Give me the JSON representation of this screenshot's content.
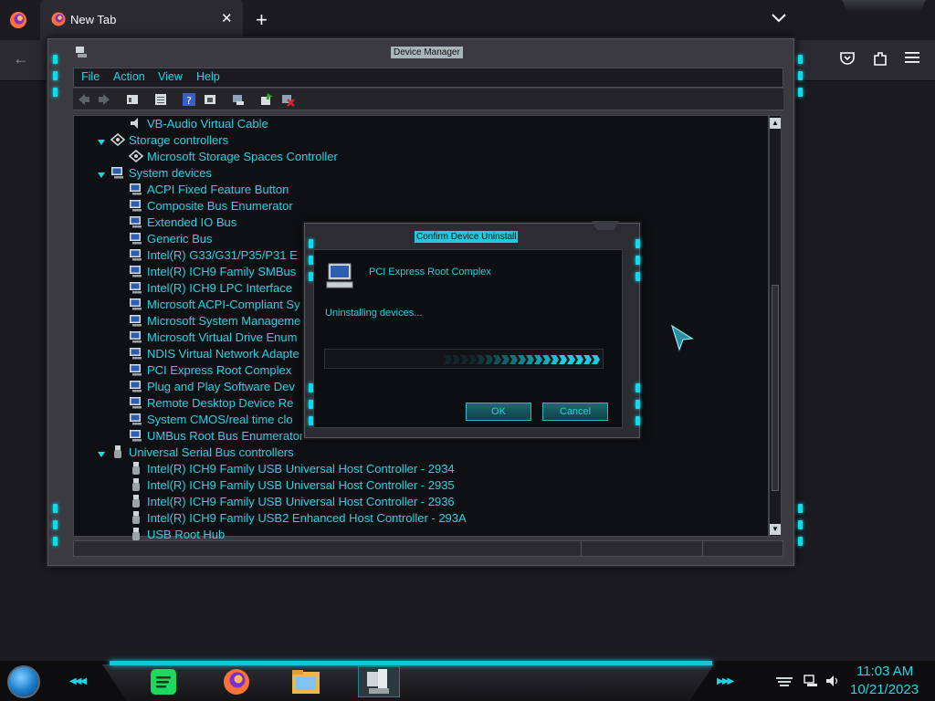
{
  "browser": {
    "tab_title": "New Tab",
    "close_glyph": "✕",
    "new_tab_glyph": "+",
    "back_glyph": "←"
  },
  "device_manager": {
    "title": "Device Manager",
    "menu": [
      "File",
      "Action",
      "View",
      "Help"
    ],
    "tree": [
      {
        "label": "VB-Audio Virtual Cable",
        "level": 2,
        "icon": "speaker-icon"
      },
      {
        "label": "Storage controllers",
        "level": 1,
        "icon": "storage-icon",
        "expanded": true
      },
      {
        "label": "Microsoft Storage Spaces Controller",
        "level": 2,
        "icon": "storage-icon"
      },
      {
        "label": "System devices",
        "level": 1,
        "icon": "computer-icon",
        "expanded": true
      },
      {
        "label": "ACPI Fixed Feature Button",
        "level": 2,
        "icon": "computer-icon"
      },
      {
        "label": "Composite Bus Enumerator",
        "level": 2,
        "icon": "computer-icon"
      },
      {
        "label": "Extended IO Bus",
        "level": 2,
        "icon": "computer-icon"
      },
      {
        "label": "Generic Bus",
        "level": 2,
        "icon": "computer-icon"
      },
      {
        "label": "Intel(R) G33/G31/P35/P31 E",
        "level": 2,
        "icon": "computer-icon"
      },
      {
        "label": "Intel(R) ICH9 Family SMBus",
        "level": 2,
        "icon": "computer-icon"
      },
      {
        "label": "Intel(R) ICH9 LPC Interface",
        "level": 2,
        "icon": "computer-icon"
      },
      {
        "label": "Microsoft ACPI-Compliant Sy",
        "level": 2,
        "icon": "computer-icon"
      },
      {
        "label": "Microsoft System Manageme",
        "level": 2,
        "icon": "computer-icon"
      },
      {
        "label": "Microsoft Virtual Drive Enum",
        "level": 2,
        "icon": "computer-icon"
      },
      {
        "label": "NDIS Virtual Network Adapte",
        "level": 2,
        "icon": "computer-icon"
      },
      {
        "label": "PCI Express Root Complex",
        "level": 2,
        "icon": "computer-icon"
      },
      {
        "label": "Plug and Play Software Dev",
        "level": 2,
        "icon": "computer-icon"
      },
      {
        "label": "Remote Desktop Device Re",
        "level": 2,
        "icon": "computer-icon"
      },
      {
        "label": "System CMOS/real time clo",
        "level": 2,
        "icon": "computer-icon"
      },
      {
        "label": "UMBus Root Bus Enumerator",
        "level": 2,
        "icon": "computer-icon"
      },
      {
        "label": "Universal Serial Bus controllers",
        "level": 1,
        "icon": "usb-icon",
        "expanded": true
      },
      {
        "label": "Intel(R) ICH9 Family USB Universal Host Controller - 2934",
        "level": 2,
        "icon": "usb-icon"
      },
      {
        "label": "Intel(R) ICH9 Family USB Universal Host Controller - 2935",
        "level": 2,
        "icon": "usb-icon"
      },
      {
        "label": "Intel(R) ICH9 Family USB Universal Host Controller - 2936",
        "level": 2,
        "icon": "usb-icon"
      },
      {
        "label": "Intel(R) ICH9 Family USB2 Enhanced Host Controller - 293A",
        "level": 2,
        "icon": "usb-icon"
      },
      {
        "label": "USB Root Hub",
        "level": 2,
        "icon": "usb-icon"
      }
    ]
  },
  "dialog": {
    "title": "Confirm Device Uninstall",
    "device_name": "PCI Express Root Complex",
    "status": "Uninstalling devices...",
    "ok_label": "OK",
    "cancel_label": "Cancel"
  },
  "taskbar": {
    "apps": [
      "spotify-icon",
      "firefox-icon",
      "file-explorer-icon",
      "device-manager-icon"
    ],
    "time": "11:03 AM",
    "date": "10/21/2023"
  },
  "colors": {
    "accent": "#1fd5e6",
    "chrome_bg": "#1c1b22",
    "tab_bg": "#2b2a33"
  }
}
